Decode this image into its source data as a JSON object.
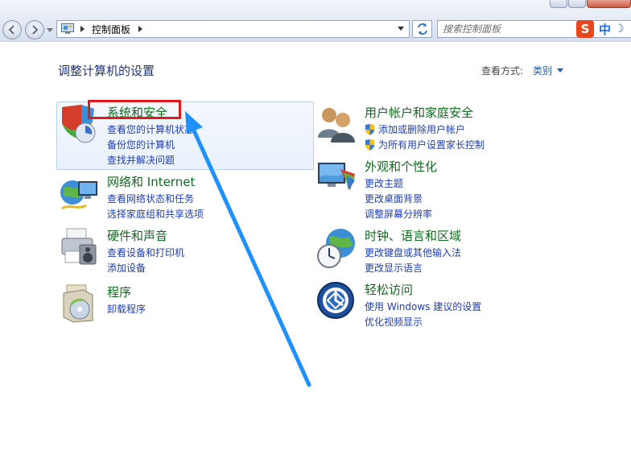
{
  "address": {
    "crumb": "控制面板",
    "search_placeholder": "搜索控制面板"
  },
  "ime": {
    "logo": "S",
    "lang": "中",
    "moon": "☽"
  },
  "heading": "调整计算机的设置",
  "view_by": {
    "label": "查看方式:",
    "value": "类别"
  },
  "categories": [
    {
      "title": "系统和安全",
      "links": [
        "查看您的计算机状态",
        "备份您的计算机",
        "查找并解决问题"
      ]
    },
    {
      "title": "网络和 Internet",
      "links": [
        "查看网络状态和任务",
        "选择家庭组和共享选项"
      ]
    },
    {
      "title": "硬件和声音",
      "links": [
        "查看设备和打印机",
        "添加设备"
      ]
    },
    {
      "title": "程序",
      "links": [
        "卸载程序"
      ]
    },
    {
      "title": "用户帐户和家庭安全",
      "links": [
        "添加或删除用户帐户",
        "为所有用户设置家长控制"
      ]
    },
    {
      "title": "外观和个性化",
      "links": [
        "更改主题",
        "更改桌面背景",
        "调整屏幕分辨率"
      ]
    },
    {
      "title": "时钟、语言和区域",
      "links": [
        "更改键盘或其他输入法",
        "更改显示语言"
      ]
    },
    {
      "title": "轻松访问",
      "links": [
        "使用 Windows 建议的设置",
        "优化视频显示"
      ]
    }
  ],
  "colors": {
    "category_title": "#0f6b1e",
    "link": "#1e3db8",
    "highlight_box": "#e01b1b",
    "arrow": "#1e90ff"
  }
}
